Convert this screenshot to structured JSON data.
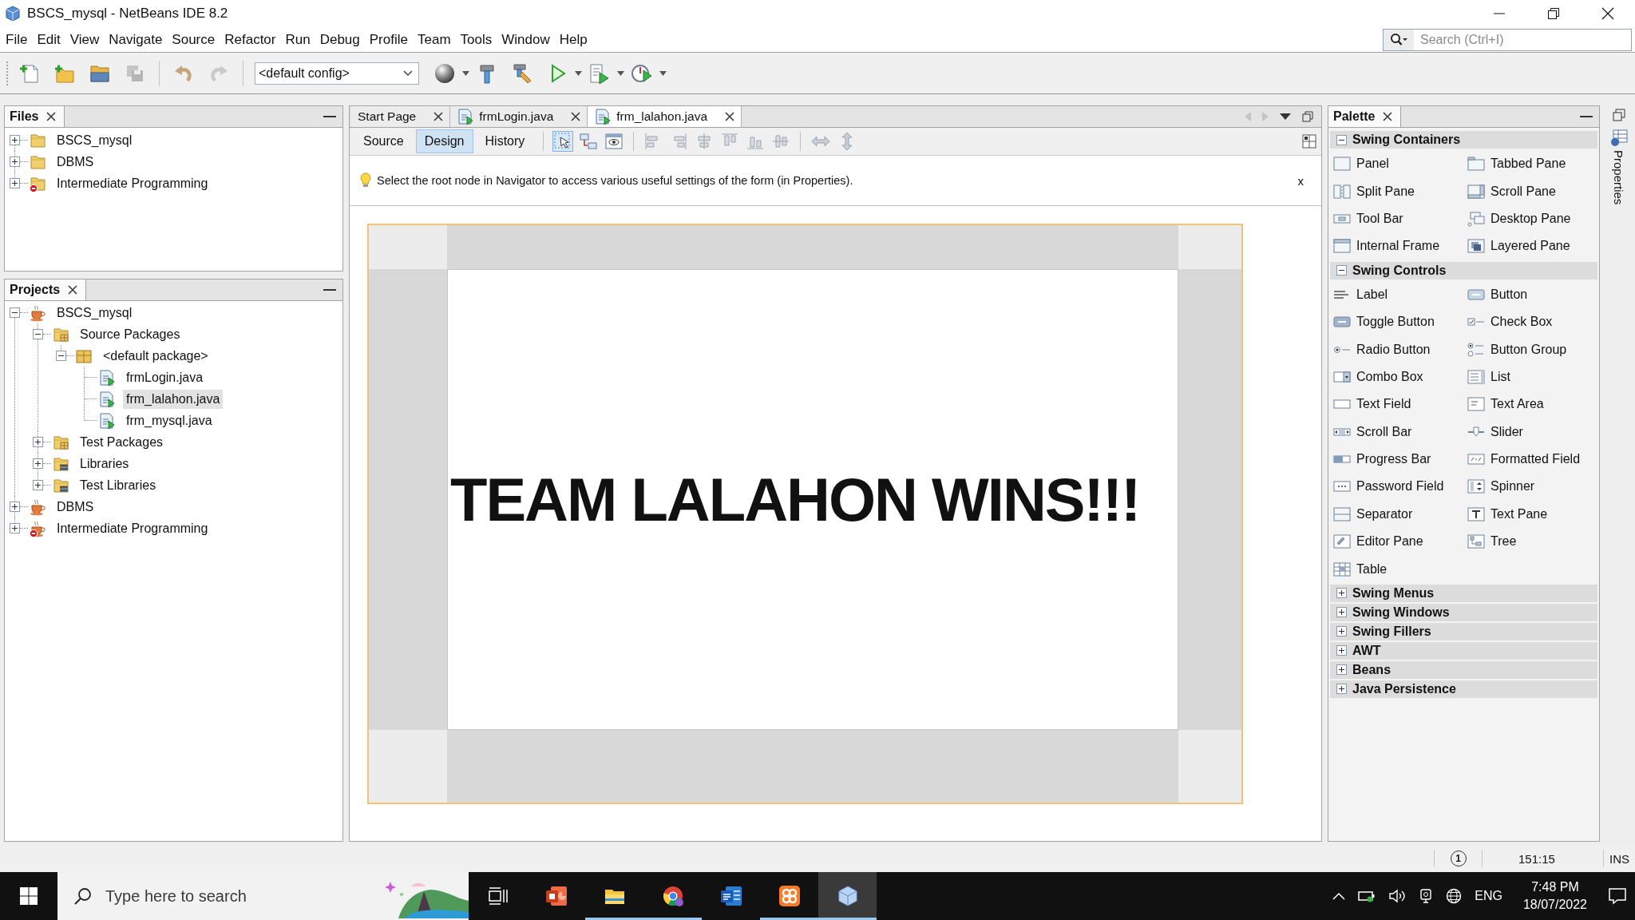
{
  "window": {
    "title": "BSCS_mysql - NetBeans IDE 8.2"
  },
  "menu": [
    "File",
    "Edit",
    "View",
    "Navigate",
    "Source",
    "Refactor",
    "Run",
    "Debug",
    "Profile",
    "Team",
    "Tools",
    "Window",
    "Help"
  ],
  "search": {
    "placeholder": "Search (Ctrl+I)"
  },
  "toolbar": {
    "file_buttons": [
      {
        "kind": "new-file",
        "disabled": false
      },
      {
        "kind": "new-project",
        "disabled": false
      },
      {
        "kind": "open-project",
        "disabled": false
      },
      {
        "kind": "save-all",
        "disabled": true
      }
    ],
    "edit_buttons": [
      {
        "kind": "undo",
        "disabled": false
      },
      {
        "kind": "redo",
        "disabled": true
      }
    ],
    "config": "<default config>",
    "run_buttons": [
      {
        "kind": "globe"
      },
      {
        "kind": "build"
      },
      {
        "kind": "clean-build"
      },
      {
        "kind": "run"
      },
      {
        "kind": "debug"
      },
      {
        "kind": "profile"
      }
    ]
  },
  "files": {
    "title": "Files",
    "items": [
      {
        "label": "BSCS_mysql",
        "kind": "folder",
        "expanded": false,
        "error": false,
        "selected": false
      },
      {
        "label": "DBMS",
        "kind": "folder",
        "expanded": false,
        "error": false,
        "selected": false
      },
      {
        "label": "Intermediate Programming",
        "kind": "folder",
        "expanded": false,
        "error": true,
        "selected": false
      }
    ]
  },
  "projects": {
    "title": "Projects",
    "items": [
      {
        "label": "BSCS_mysql",
        "kind": "project",
        "expanded": true,
        "error": false,
        "selected": false,
        "children": [
          {
            "label": "Source Packages",
            "kind": "packages",
            "expanded": true,
            "selected": false,
            "children": [
              {
                "label": "<default package>",
                "kind": "package",
                "expanded": true,
                "selected": false,
                "children": [
                  {
                    "label": "frmLogin.java",
                    "kind": "form",
                    "selected": false
                  },
                  {
                    "label": "frm_lalahon.java",
                    "kind": "form",
                    "selected": true
                  },
                  {
                    "label": "frm_mysql.java",
                    "kind": "form",
                    "selected": false
                  }
                ]
              }
            ]
          },
          {
            "label": "Test Packages",
            "kind": "packages",
            "expanded": false,
            "selected": false
          },
          {
            "label": "Libraries",
            "kind": "libraries",
            "expanded": false,
            "selected": false
          },
          {
            "label": "Test Libraries",
            "kind": "libraries",
            "expanded": false,
            "selected": false
          }
        ]
      },
      {
        "label": "DBMS",
        "kind": "project",
        "expanded": false,
        "error": false,
        "selected": false
      },
      {
        "label": "Intermediate Programming",
        "kind": "project",
        "expanded": false,
        "error": true,
        "selected": false
      }
    ]
  },
  "editor": {
    "tabs": [
      {
        "label": "Start Page",
        "kind": "page",
        "selected": false
      },
      {
        "label": "frmLogin.java",
        "kind": "form",
        "selected": false
      },
      {
        "label": "frm_lalahon.java",
        "kind": "form",
        "selected": true
      }
    ],
    "views": [
      {
        "label": "Source",
        "selected": false
      },
      {
        "label": "Design",
        "selected": true
      },
      {
        "label": "History",
        "selected": false
      }
    ],
    "tools": [
      {
        "kind": "selection",
        "selected": true
      },
      {
        "kind": "connection",
        "selected": false
      },
      {
        "kind": "preview",
        "selected": false
      }
    ],
    "hint": "Select the root node in Navigator to access various useful settings of the form (in Properties).",
    "hint_close": "x",
    "form": {
      "label": "TEAM LALAHON WINS!!!"
    }
  },
  "palette": {
    "title": "Palette",
    "categories": [
      {
        "label": "Swing Containers",
        "expanded": true,
        "items": [
          "Panel",
          "Tabbed Pane",
          "Split Pane",
          "Scroll Pane",
          "Tool Bar",
          "Desktop Pane",
          "Internal Frame",
          "Layered Pane"
        ]
      },
      {
        "label": "Swing Controls",
        "expanded": true,
        "items": [
          "Label",
          "Button",
          "Toggle Button",
          "Check Box",
          "Radio Button",
          "Button Group",
          "Combo Box",
          "List",
          "Text Field",
          "Text Area",
          "Scroll Bar",
          "Slider",
          "Progress Bar",
          "Formatted Field",
          "Password Field",
          "Spinner",
          "Separator",
          "Text Pane",
          "Editor Pane",
          "Tree",
          "Table"
        ]
      },
      {
        "label": "Swing Menus",
        "expanded": false
      },
      {
        "label": "Swing Windows",
        "expanded": false
      },
      {
        "label": "Swing Fillers",
        "expanded": false
      },
      {
        "label": "AWT",
        "expanded": false
      },
      {
        "label": "Beans",
        "expanded": false
      },
      {
        "label": "Java Persistence",
        "expanded": false
      }
    ]
  },
  "side_panel": {
    "label": "Properties"
  },
  "status_bar": {
    "notifications": "1",
    "position": "151:15",
    "mode": "INS"
  },
  "taskbar": {
    "search_placeholder": "Type here to search",
    "apps": [
      {
        "kind": "powerpoint",
        "running": false,
        "selected": false
      },
      {
        "kind": "file-explorer",
        "running": true,
        "selected": false
      },
      {
        "kind": "chrome",
        "running": true,
        "selected": false
      },
      {
        "kind": "word",
        "running": false,
        "selected": false
      },
      {
        "kind": "xampp",
        "running": true,
        "selected": false
      },
      {
        "kind": "netbeans",
        "running": true,
        "selected": true
      }
    ],
    "language": "ENG",
    "time": "7:48 PM",
    "date": "18/07/2022"
  }
}
